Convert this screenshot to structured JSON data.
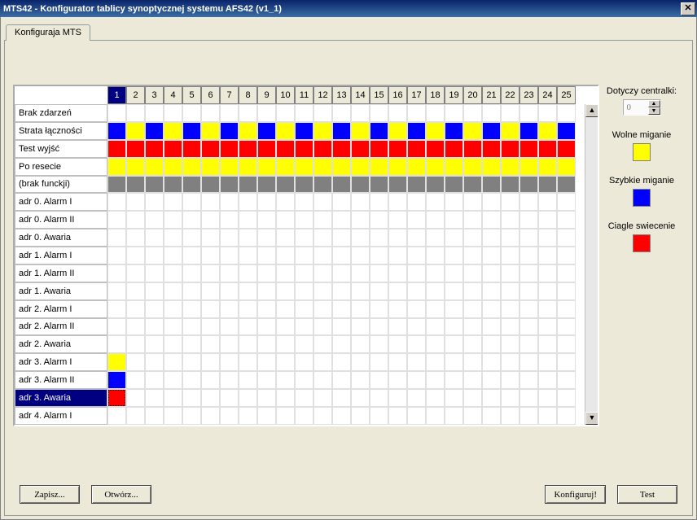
{
  "window": {
    "title": "MTS42 - Konfigurator tablicy synoptycznej systemu AFS42 (v1_1)"
  },
  "tab_label": "Konfiguraja MTS",
  "columns": [
    "1",
    "2",
    "3",
    "4",
    "5",
    "6",
    "7",
    "8",
    "9",
    "10",
    "11",
    "12",
    "13",
    "14",
    "15",
    "16",
    "17",
    "18",
    "19",
    "20",
    "21",
    "22",
    "23",
    "24",
    "25"
  ],
  "selected_column": 0,
  "selected_row": 14,
  "rows": [
    {
      "label": "Brak zdarzeń",
      "cells": []
    },
    {
      "label": "Strata łączności",
      "cells": [
        "blue",
        "yellow",
        "blue",
        "yellow",
        "blue",
        "yellow",
        "blue",
        "yellow",
        "blue",
        "yellow",
        "blue",
        "yellow",
        "blue",
        "yellow",
        "blue",
        "yellow",
        "blue",
        "yellow",
        "blue",
        "yellow",
        "blue",
        "yellow",
        "blue",
        "yellow",
        "blue"
      ]
    },
    {
      "label": "Test wyjść",
      "cells": [
        "red",
        "red",
        "red",
        "red",
        "red",
        "red",
        "red",
        "red",
        "red",
        "red",
        "red",
        "red",
        "red",
        "red",
        "red",
        "red",
        "red",
        "red",
        "red",
        "red",
        "red",
        "red",
        "red",
        "red",
        "red"
      ]
    },
    {
      "label": "Po resecie",
      "cells": [
        "yellow",
        "yellow",
        "yellow",
        "yellow",
        "yellow",
        "yellow",
        "yellow",
        "yellow",
        "yellow",
        "yellow",
        "yellow",
        "yellow",
        "yellow",
        "yellow",
        "yellow",
        "yellow",
        "yellow",
        "yellow",
        "yellow",
        "yellow",
        "yellow",
        "yellow",
        "yellow",
        "yellow",
        "yellow"
      ]
    },
    {
      "label": "(brak funckji)",
      "cells": [
        "gray",
        "gray",
        "gray",
        "gray",
        "gray",
        "gray",
        "gray",
        "gray",
        "gray",
        "gray",
        "gray",
        "gray",
        "gray",
        "gray",
        "gray",
        "gray",
        "gray",
        "gray",
        "gray",
        "gray",
        "gray",
        "gray",
        "gray",
        "gray",
        "gray"
      ]
    },
    {
      "label": "adr 0. Alarm I",
      "cells": []
    },
    {
      "label": "adr 0. Alarm II",
      "cells": []
    },
    {
      "label": "adr 0. Awaria",
      "cells": []
    },
    {
      "label": "adr 1. Alarm I",
      "cells": []
    },
    {
      "label": "adr 1. Alarm II",
      "cells": []
    },
    {
      "label": "adr 1. Awaria",
      "cells": []
    },
    {
      "label": "adr 2. Alarm I",
      "cells": []
    },
    {
      "label": "adr 2. Alarm II",
      "cells": []
    },
    {
      "label": "adr 2. Awaria",
      "cells": []
    },
    {
      "label": "adr 3. Alarm I",
      "cells": [
        "yellow"
      ]
    },
    {
      "label": "adr 3. Alarm II",
      "cells": [
        "blue"
      ]
    },
    {
      "label": "adr 3. Awaria",
      "cells": [
        "red"
      ],
      "selected": true
    },
    {
      "label": "adr 4. Alarm I",
      "cells": []
    }
  ],
  "side": {
    "centralki_label": "Dotyczy centralki:",
    "centralki_value": "0",
    "legend": [
      {
        "label": "Wolne miganie",
        "color": "#ffff00"
      },
      {
        "label": "Szybkie miganie",
        "color": "#0000ff"
      },
      {
        "label": "Ciagle swiecenie",
        "color": "#ff0000"
      }
    ]
  },
  "buttons": {
    "zapisz": "Zapisz...",
    "otworz": "Otwórz...",
    "konfiguruj": "Konfiguruj!",
    "test": "Test"
  },
  "colors": {
    "yellow": "#ffff00",
    "blue": "#0000ff",
    "red": "#ff0000",
    "gray": "#808080"
  }
}
